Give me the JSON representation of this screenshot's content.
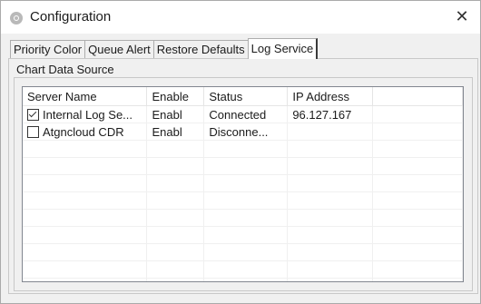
{
  "window": {
    "title": "Configuration",
    "close_glyph": "✕",
    "icon": "gear-icon"
  },
  "tabs": [
    {
      "label": "Priority Color",
      "active": false
    },
    {
      "label": "Queue Alert",
      "active": false
    },
    {
      "label": "Restore Defaults",
      "active": false
    },
    {
      "label": "Log Service",
      "active": true
    }
  ],
  "group": {
    "label": "Chart Data Source"
  },
  "list": {
    "columns": [
      "Server Name",
      "Enable",
      "Status",
      "IP Address"
    ],
    "rows": [
      {
        "checked": true,
        "name": "Internal Log Se...",
        "enable": "Enabl",
        "status": "Connected",
        "ip": "96.127.167"
      },
      {
        "checked": false,
        "name": "Atgncloud CDR",
        "enable": "Enabl",
        "status": "Disconne...",
        "ip": ""
      }
    ]
  }
}
